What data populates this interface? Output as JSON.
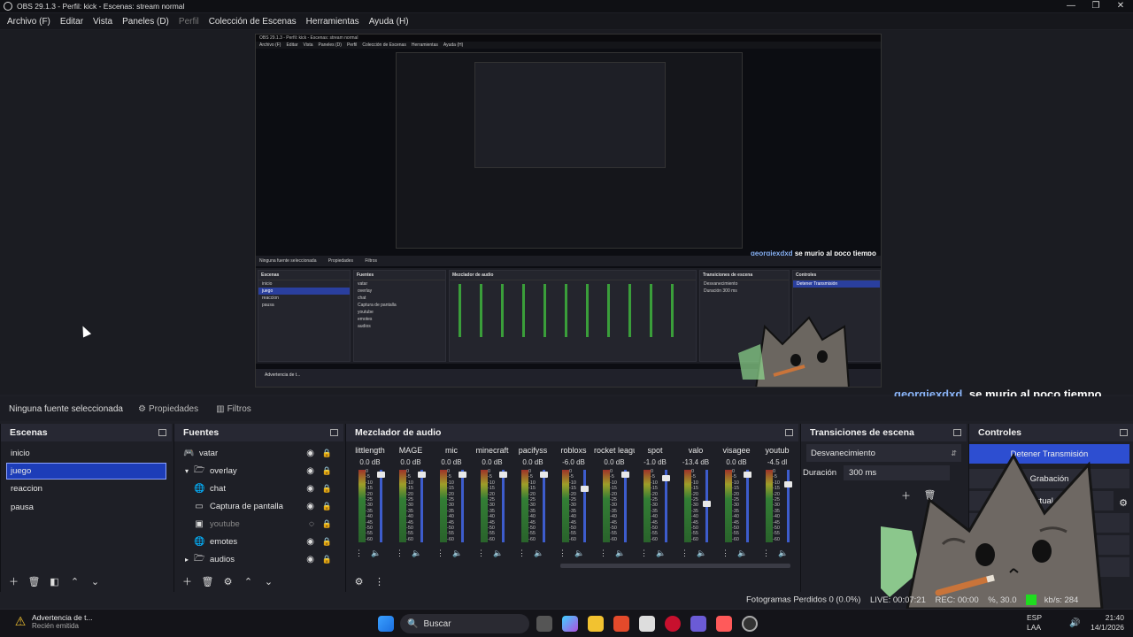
{
  "window": {
    "title": "OBS 29.1.3 - Perfil: kick - Escenas: stream normal",
    "controls": [
      "—",
      "❐",
      "✕"
    ]
  },
  "menu": [
    {
      "label": "Archivo (F)",
      "dim": false
    },
    {
      "label": "Editar",
      "dim": false
    },
    {
      "label": "Vista",
      "dim": false
    },
    {
      "label": "Paneles (D)",
      "dim": false
    },
    {
      "label": "Perfil",
      "dim": true
    },
    {
      "label": "Colección de Escenas",
      "dim": false
    },
    {
      "label": "Herramientas",
      "dim": false
    },
    {
      "label": "Ayuda (H)",
      "dim": false
    }
  ],
  "preview": {
    "title": "OBS 29.1.3 - Perfil: kick - Escenas: stream normal",
    "menu": [
      "Archivo (F)",
      "Editar",
      "Vista",
      "Paneles (D)",
      "Perfil",
      "Colección de Escenas",
      "Herramientas",
      "Ayuda (H)"
    ],
    "chat_user": "georgiexdxd",
    "chat_msg": "se murio al poco tiempo",
    "nosrc": "Ninguna fuente seleccionada",
    "props": "Propiedades",
    "filters": "Filtros",
    "scenes_h": "Escenas",
    "sources_h": "Fuentes",
    "mixer_h": "Mezclador de audio",
    "trans_h": "Transiciones de escena",
    "ctrl_h": "Controles",
    "trans_val": "Desvanecimiento",
    "dur": "Duración",
    "dur_val": "300 ms",
    "stop_stream": "Detener Transmisión",
    "warn": "Advertencia de t..."
  },
  "propbar": {
    "nosrc": "Ninguna fuente seleccionada",
    "props": "Propiedades",
    "filters": "Filtros"
  },
  "chat": {
    "user": "georgiexdxd",
    "msg": "se murio al poco tiempo"
  },
  "scenes": {
    "title": "Escenas",
    "items": [
      {
        "label": "inicio",
        "selected": false
      },
      {
        "label": "juego",
        "selected": true
      },
      {
        "label": "reaccion",
        "selected": false
      },
      {
        "label": "pausa",
        "selected": false
      }
    ]
  },
  "sources": {
    "title": "Fuentes",
    "items": [
      {
        "label": "vatar",
        "icon": "gamepad-icon",
        "glyph": "🎮",
        "indent": 0,
        "expand": "",
        "dim": false
      },
      {
        "label": "overlay",
        "icon": "folder-icon",
        "glyph": "🗁",
        "indent": 1,
        "expand": "▾",
        "dim": false
      },
      {
        "label": "chat",
        "icon": "globe-icon",
        "glyph": "🌐",
        "indent": 1,
        "expand": "",
        "dim": false
      },
      {
        "label": "Captura de pantalla",
        "icon": "monitor-icon",
        "glyph": "▭",
        "indent": 1,
        "expand": "",
        "dim": false
      },
      {
        "label": "youtube",
        "icon": "image-icon",
        "glyph": "▣",
        "indent": 1,
        "expand": "",
        "dim": true
      },
      {
        "label": "emotes",
        "icon": "globe-icon",
        "glyph": "🌐",
        "indent": 1,
        "expand": "",
        "dim": false
      },
      {
        "label": "audios",
        "icon": "folder-icon",
        "glyph": "🗁",
        "indent": 1,
        "expand": "▸",
        "dim": false
      }
    ]
  },
  "mixer": {
    "title": "Mezclador de audio",
    "scale": [
      "0",
      "-5",
      "-10",
      "-15",
      "-20",
      "-25",
      "-30",
      "-35",
      "-40",
      "-45",
      "-50",
      "-55",
      "-60"
    ],
    "channels": [
      {
        "name": "littlength",
        "db": "0.0 dB",
        "level": 0.98
      },
      {
        "name": "MAGE",
        "db": "0.0 dB",
        "level": 0.98
      },
      {
        "name": "mic",
        "db": "0.0 dB",
        "level": 0.98
      },
      {
        "name": "minecraft",
        "db": "0.0 dB",
        "level": 0.98
      },
      {
        "name": "pacifyss",
        "db": "0.0 dB",
        "level": 0.98
      },
      {
        "name": "robloxs",
        "db": "-6.0 dB",
        "level": 0.78
      },
      {
        "name": "rocket league",
        "db": "0.0 dB",
        "level": 0.98
      },
      {
        "name": "spot",
        "db": "-1.0 dB",
        "level": 0.93
      },
      {
        "name": "valo",
        "db": "-13.4 dB",
        "level": 0.57
      },
      {
        "name": "visagee",
        "db": "0.0 dB",
        "level": 0.98
      },
      {
        "name": "youtub",
        "db": "-4.5 dl",
        "level": 0.84
      }
    ]
  },
  "transitions": {
    "title": "Transiciones de escena",
    "type": "Desvanecimiento",
    "duration_label": "Duración",
    "duration_value": "300 ms"
  },
  "controls": {
    "title": "Controles",
    "buttons": [
      "Detener Transmisión",
      "Grabación",
      "Virtual",
      "o",
      "",
      ""
    ]
  },
  "status": {
    "dropped": "Fotogramas Perdidos 0 (0.0%)",
    "live": "LIVE: 00:07:21",
    "rec": "REC: 00:00",
    "cpu": "%, 30.0",
    "kbps": "kb/s: 284"
  },
  "taskbar": {
    "notify_title": "Advertencia de t...",
    "notify_sub": "Recién emitida",
    "search": "Buscar",
    "lang_top": "ESP",
    "lang_bottom": "LAA",
    "time": "21:40",
    "date": "14/1/2026"
  },
  "colors": {
    "accent": "#2d4ed1",
    "selection": "#1d3db8",
    "bg": "#1e1f26"
  }
}
